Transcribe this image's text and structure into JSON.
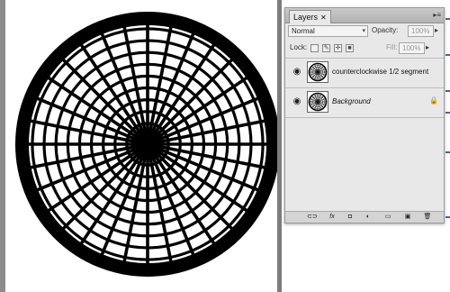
{
  "document": {
    "art": {
      "type": "circular-grid-wheel",
      "spokes": 32,
      "rings": 9,
      "color": "#000000",
      "background": "#ffffff"
    }
  },
  "layers_panel": {
    "tab_label": "Layers",
    "tab_close": "✕",
    "menu_icon": "panel-menu-icon",
    "blend_mode": "Normal",
    "opacity_label": "Opacity:",
    "opacity_value": "100%",
    "lock_label": "Lock:",
    "fill_label": "Fill:",
    "fill_value": "100%",
    "layers": [
      {
        "name": "counterclockwise 1/2 segment",
        "visible": true,
        "locked": false,
        "italic": false
      },
      {
        "name": "Background",
        "visible": true,
        "locked": true,
        "italic": true
      }
    ],
    "footer_buttons": [
      "link-layers-icon",
      "fx-icon",
      "layer-mask-icon",
      "adjustment-layer-icon",
      "new-group-icon",
      "new-layer-icon",
      "delete-layer-icon"
    ],
    "footer_glyphs": [
      "⊂⊃",
      "fx",
      "◘",
      "◐",
      "▭",
      "▣",
      "🗑"
    ]
  }
}
